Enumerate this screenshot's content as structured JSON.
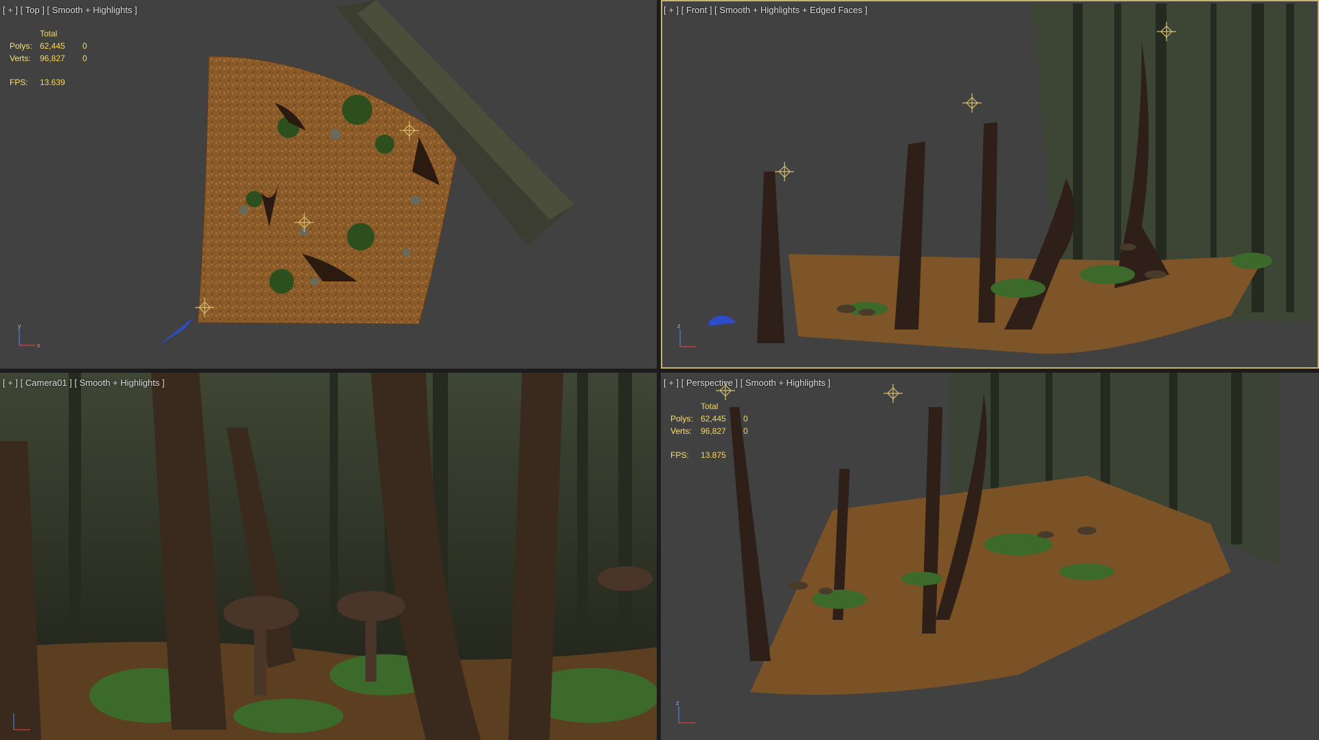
{
  "viewports": {
    "top": {
      "label": "[ + ] [ Top ] [ Smooth + Highlights ]"
    },
    "front": {
      "label": "[ + ] [ Front ] [ Smooth + Highlights + Edged Faces ]"
    },
    "camera": {
      "label": "[ + ] [ Camera01 ] [ Smooth + Highlights ]"
    },
    "perspective": {
      "label": "[ + ] [ Perspective ] [ Smooth + Highlights ]"
    }
  },
  "stats_top": {
    "header": "Total",
    "polys_label": "Polys:",
    "polys_total": "62,445",
    "polys_sel": "0",
    "verts_label": "Verts:",
    "verts_total": "96,827",
    "verts_sel": "0",
    "fps_label": "FPS:",
    "fps_value": "13.639"
  },
  "stats_persp": {
    "header": "Total",
    "polys_label": "Polys:",
    "polys_total": "62,445",
    "polys_sel": "0",
    "verts_label": "Verts:",
    "verts_total": "96,827",
    "verts_sel": "0",
    "fps_label": "FPS:",
    "fps_value": "13.875"
  },
  "colors": {
    "viewport_bg": "#414141",
    "active_border": "#c8b46a",
    "stats_text": "#ffd84a",
    "ground": "#8a5a28",
    "foliage": "#3c6a2a"
  },
  "axis": {
    "x": "x",
    "y": "y",
    "z": "z"
  }
}
